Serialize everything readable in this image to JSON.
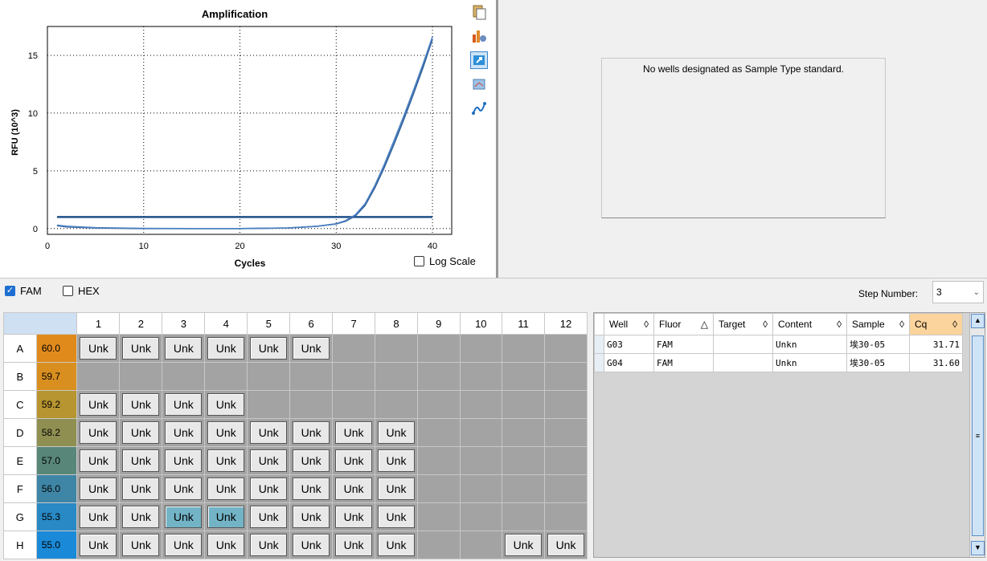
{
  "chart": {
    "title": "Amplification",
    "ylabel": "RFU (10^3)",
    "xlabel": "Cycles",
    "log_scale_label": "Log Scale",
    "x_ticks": [
      "0",
      "10",
      "20",
      "30",
      "40"
    ],
    "y_ticks": [
      "0",
      "5",
      "10",
      "15"
    ]
  },
  "chart_data": {
    "type": "line",
    "title": "Amplification",
    "xlabel": "Cycles",
    "ylabel": "RFU (10^3)",
    "xlim": [
      0,
      42
    ],
    "ylim": [
      -0.5,
      17.5
    ],
    "grid": true,
    "threshold": 1.0,
    "series": [
      {
        "x": [
          1,
          2,
          5,
          10,
          15,
          20,
          25,
          28,
          30,
          31,
          32,
          33,
          34,
          35,
          36,
          37,
          38,
          39,
          40
        ],
        "y": [
          0.25,
          0.15,
          0.05,
          0.0,
          0.0,
          0.0,
          0.05,
          0.2,
          0.4,
          0.65,
          1.1,
          2.0,
          3.5,
          5.3,
          7.3,
          9.4,
          11.6,
          13.9,
          16.4
        ]
      },
      {
        "x": [
          1,
          2,
          5,
          10,
          15,
          20,
          25,
          28,
          30,
          31,
          32,
          33,
          34,
          35,
          36,
          37,
          38,
          39,
          40
        ],
        "y": [
          0.3,
          0.2,
          0.08,
          0.02,
          0.0,
          0.0,
          0.05,
          0.2,
          0.42,
          0.7,
          1.2,
          2.15,
          3.7,
          5.55,
          7.6,
          9.7,
          11.9,
          14.2,
          16.6
        ]
      }
    ]
  },
  "std_message": "No wells designated as Sample Type standard.",
  "fluors": [
    {
      "label": "FAM",
      "checked": true
    },
    {
      "label": "HEX",
      "checked": false
    }
  ],
  "step": {
    "label": "Step Number:",
    "value": "3"
  },
  "plate": {
    "columns": [
      "1",
      "2",
      "3",
      "4",
      "5",
      "6",
      "7",
      "8",
      "9",
      "10",
      "11",
      "12"
    ],
    "rows": [
      {
        "label": "A",
        "temp": "60.0",
        "color": "#e18a1c",
        "wells": [
          1,
          1,
          1,
          1,
          1,
          1,
          0,
          0,
          0,
          0,
          0,
          0
        ]
      },
      {
        "label": "B",
        "temp": "59.7",
        "color": "#d98f1f",
        "wells": [
          0,
          0,
          0,
          0,
          0,
          0,
          0,
          0,
          0,
          0,
          0,
          0
        ]
      },
      {
        "label": "C",
        "temp": "59.2",
        "color": "#b79530",
        "wells": [
          1,
          1,
          1,
          1,
          0,
          0,
          0,
          0,
          0,
          0,
          0,
          0
        ]
      },
      {
        "label": "D",
        "temp": "58.2",
        "color": "#8f8f52",
        "wells": [
          1,
          1,
          1,
          1,
          1,
          1,
          1,
          1,
          0,
          0,
          0,
          0
        ]
      },
      {
        "label": "E",
        "temp": "57.0",
        "color": "#58877a",
        "wells": [
          1,
          1,
          1,
          1,
          1,
          1,
          1,
          1,
          0,
          0,
          0,
          0
        ]
      },
      {
        "label": "F",
        "temp": "56.0",
        "color": "#3f86a6",
        "wells": [
          1,
          1,
          1,
          1,
          1,
          1,
          1,
          1,
          0,
          0,
          0,
          0
        ]
      },
      {
        "label": "G",
        "temp": "55.3",
        "color": "#2889c4",
        "wells": [
          1,
          1,
          2,
          2,
          1,
          1,
          1,
          1,
          0,
          0,
          0,
          0
        ]
      },
      {
        "label": "H",
        "temp": "55.0",
        "color": "#1a8ad8",
        "wells": [
          1,
          1,
          1,
          1,
          1,
          1,
          1,
          1,
          0,
          0,
          1,
          1
        ]
      }
    ],
    "well_label": "Unk"
  },
  "results": {
    "headers": [
      "Well",
      "Fluor",
      "Target",
      "Content",
      "Sample",
      "Cq"
    ],
    "sort_icons": [
      "◊",
      "△",
      "◊",
      "◊",
      "◊",
      "◊"
    ],
    "rows": [
      [
        "G03",
        "FAM",
        "",
        "Unkn",
        "埃30-05",
        "31.71"
      ],
      [
        "G04",
        "FAM",
        "",
        "Unkn",
        "埃30-05",
        "31.60"
      ]
    ]
  }
}
